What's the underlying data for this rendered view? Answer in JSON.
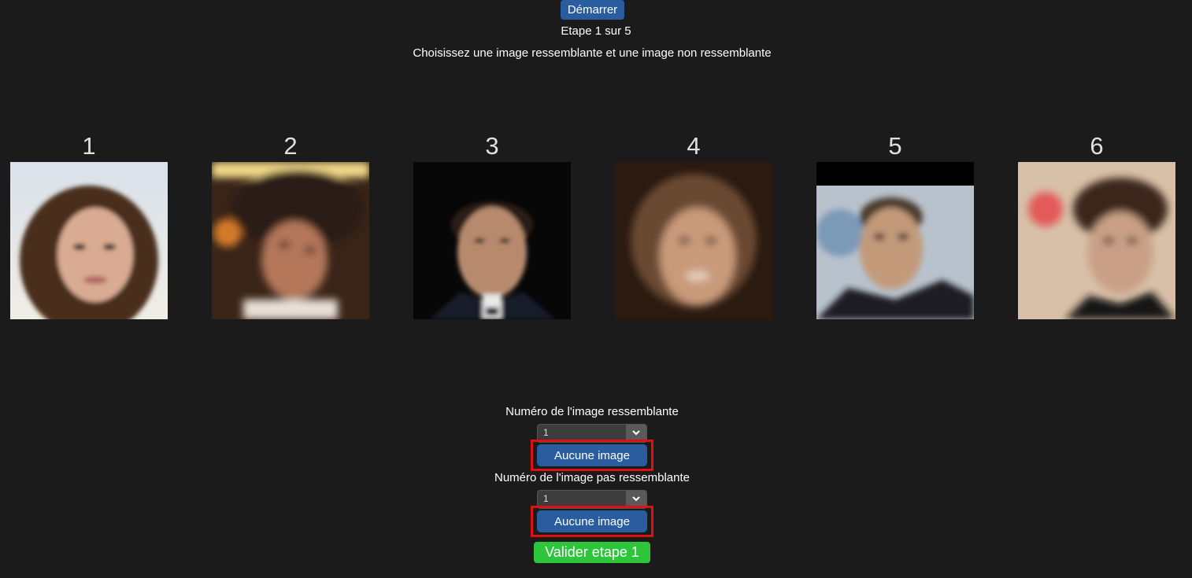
{
  "header": {
    "start_label": "Démarrer",
    "step_text": "Etape 1 sur 5",
    "instruction": "Choisissez une image ressemblante et une image non ressemblante"
  },
  "gallery": {
    "images": [
      {
        "number": "1",
        "icon": "face-image"
      },
      {
        "number": "2",
        "icon": "face-image"
      },
      {
        "number": "3",
        "icon": "face-image"
      },
      {
        "number": "4",
        "icon": "face-image"
      },
      {
        "number": "5",
        "icon": "face-image"
      },
      {
        "number": "6",
        "icon": "face-image"
      }
    ]
  },
  "form": {
    "similar_label": "Numéro de l'image ressemblante",
    "similar_value": "1",
    "similar_none_label": "Aucune image",
    "dissimilar_label": "Numéro de l'image pas ressemblante",
    "dissimilar_value": "1",
    "dissimilar_none_label": "Aucune image",
    "validate_label": "Valider etape 1"
  },
  "colors": {
    "background": "#1b1b1b",
    "primary_button": "#2a5d9f",
    "validate_button": "#2dc63b",
    "highlight_frame": "#e01010"
  }
}
